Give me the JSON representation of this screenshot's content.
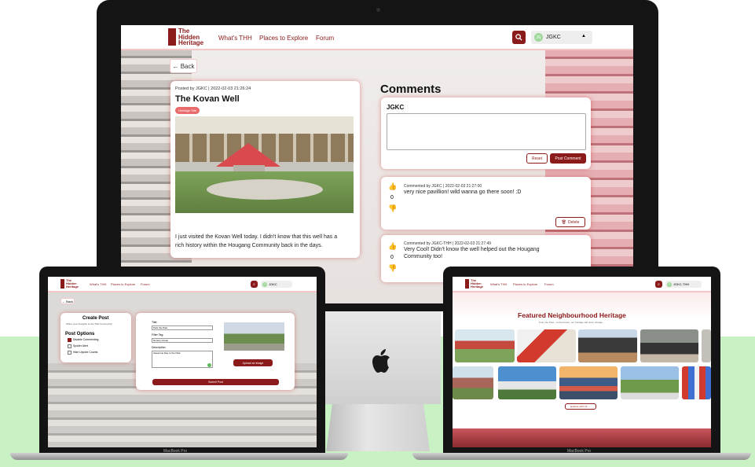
{
  "brand": {
    "line1": "The",
    "line2": "Hidden",
    "line3": "Heritage"
  },
  "nav": {
    "link1": "What's THH",
    "link2": "Places to Explore",
    "link3": "Forum",
    "user": "JGKC",
    "user2": "JGKC-THH",
    "avatar": "JG"
  },
  "post": {
    "back": "← Back",
    "meta": "Posted by JGKC | 2022-02-03 21:26:24",
    "title": "The Kovan Well",
    "tag": "Heritage Site",
    "body_line1": "I just visited the Kovan Well today. I didn't know that this well has a",
    "body_line2": "rich history within the Hougang Community back in the days."
  },
  "comments": {
    "heading": "Comments",
    "composer_user": "JGKC",
    "reset": "Reset",
    "post_btn": "Post Comment",
    "delete": "Delete",
    "c1_meta": "Commented by JGKC | 2022-02-03 21:27:00",
    "c1_text": "very nice pavillion! wild wanna go there soon! :D",
    "c1_votes": "0",
    "c2_meta": "Commented by JGKC-THH | 2022-02-03 21:27:49",
    "c2_line1": "Very Cool! Didn't know the well helped out the Hougang",
    "c2_line2": "Community too!",
    "c2_votes": "0"
  },
  "footer_strip": "Images taken from roots.gov.sg & unsplash. All rights reserved to respective owners.",
  "create": {
    "back": "← Back",
    "title": "Create Post",
    "subtitle": "Share your thoughts to the THH Community!",
    "options": "Post Options",
    "opt1": "Disable Commenting",
    "opt2": "Spoiler Alert",
    "opt3": "Hide Upvote Counts",
    "f_title": "Title:",
    "f_title_val": "Park the Park",
    "f_tag": "Filter Tag:",
    "f_tag_val": "Nursery Areas",
    "f_desc": "Description:",
    "f_desc_val": "Awesome Day to the Park",
    "upload": "Upload an Image",
    "submit": "Submit Post"
  },
  "featured": {
    "title": "Featured Neighbourhood Heritage",
    "subtitle": "From the Past... to the Future, our heritage will never change...",
    "explore": "Explore with Us! →"
  },
  "laptop_label": "MacBook Pro",
  "colors": {
    "accent": "#8b1a1a",
    "green": "#c8f2c4"
  }
}
